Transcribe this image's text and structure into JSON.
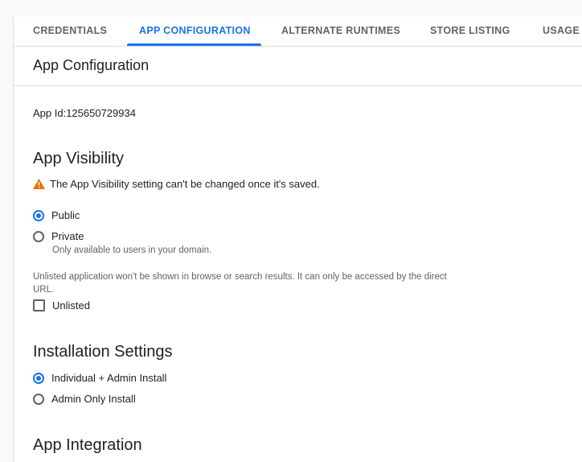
{
  "tabs": [
    {
      "label": "CREDENTIALS",
      "active": false
    },
    {
      "label": "APP CONFIGURATION",
      "active": true
    },
    {
      "label": "ALTERNATE RUNTIMES",
      "active": false
    },
    {
      "label": "STORE LISTING",
      "active": false
    },
    {
      "label": "USAGE",
      "active": false
    }
  ],
  "page": {
    "title": "App Configuration",
    "app_id": "App Id:125650729934"
  },
  "visibility": {
    "heading": "App Visibility",
    "warning": "The App Visibility setting can't be changed once it's saved.",
    "options": [
      {
        "label": "Public",
        "selected": true
      },
      {
        "label": "Private",
        "selected": false,
        "hint": "Only available to users in your domain."
      }
    ],
    "unlisted_note": "Unlisted application won't be shown in browse or search results. It can only be accessed by the direct URL.",
    "unlisted_label": "Unlisted",
    "unlisted_checked": false
  },
  "installation": {
    "heading": "Installation Settings",
    "options": [
      {
        "label": "Individual + Admin Install",
        "selected": true
      },
      {
        "label": "Admin Only Install",
        "selected": false
      }
    ]
  },
  "integration": {
    "heading": "App Integration"
  },
  "colors": {
    "accent": "#1a73e8",
    "warning": "#e37400"
  }
}
